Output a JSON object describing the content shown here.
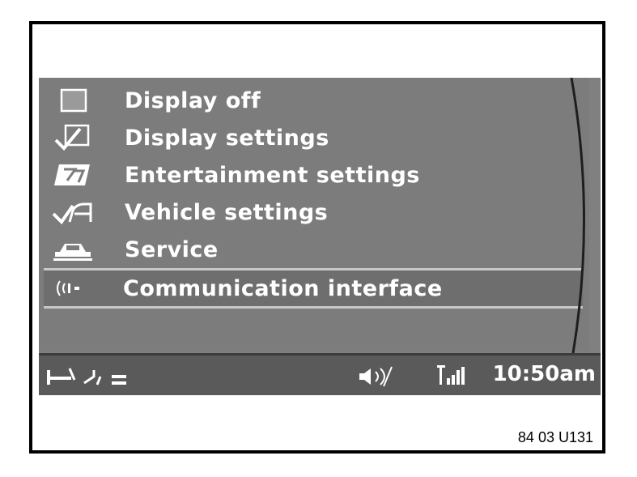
{
  "menu": {
    "items": [
      {
        "label": "Display off",
        "icon": "display-off-icon"
      },
      {
        "label": "Display settings",
        "icon": "display-settings-icon"
      },
      {
        "label": "Entertainment settings",
        "icon": "entertainment-icon"
      },
      {
        "label": "Vehicle settings",
        "icon": "vehicle-settings-icon"
      },
      {
        "label": "Service",
        "icon": "service-car-icon"
      },
      {
        "label": "Communication interface",
        "icon": "communication-interface-icon",
        "selected": true
      }
    ]
  },
  "status": {
    "time": "10:50am",
    "icons": [
      "navigation-icon",
      "traffic-info-icon",
      "audio-mute-icon",
      "phone-signal-icon"
    ]
  },
  "caption": "84 03 U131",
  "colors": {
    "screen_bg": "#7c7c7c",
    "statusbar_bg": "#5a5a5a",
    "text": "#ffffff",
    "selection_outline": "#c8c8c8"
  }
}
